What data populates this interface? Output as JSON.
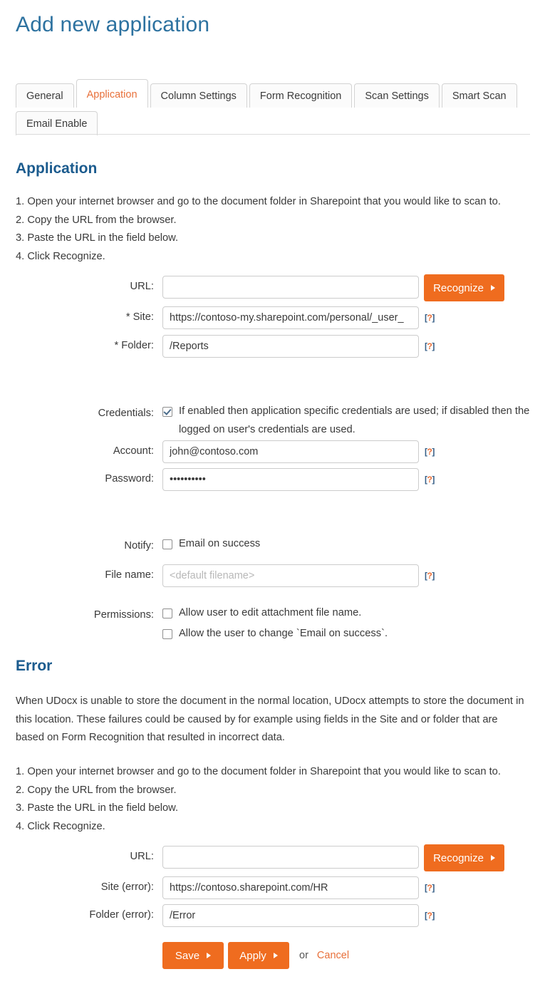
{
  "page": {
    "title": "Add new application"
  },
  "tabs": {
    "row1": [
      {
        "label": "General",
        "active": false
      },
      {
        "label": "Application",
        "active": true
      },
      {
        "label": "Column Settings",
        "active": false
      },
      {
        "label": "Form Recognition",
        "active": false
      },
      {
        "label": "Scan Settings",
        "active": false
      },
      {
        "label": "Smart Scan",
        "active": false
      }
    ],
    "row2": [
      {
        "label": "Email Enable",
        "active": false
      }
    ]
  },
  "application": {
    "heading": "Application",
    "steps": [
      "1. Open your internet browser and go to the document folder in Sharepoint that you would like to scan to.",
      "2. Copy the URL from the browser.",
      "3. Paste the URL in the field below.",
      "4. Click Recognize."
    ],
    "url": {
      "label": "URL:",
      "value": "",
      "placeholder": ""
    },
    "recognize_button": "Recognize",
    "site": {
      "label": "* Site:",
      "value": "https://contoso-my.sharepoint.com/personal/_user_",
      "help": "[?]"
    },
    "folder": {
      "label": "* Folder:",
      "value": "/Reports",
      "help": "[?]"
    },
    "credentials": {
      "label": "Credentials:",
      "checked": true,
      "text": "If enabled then application specific credentials are used; if disabled then the logged on user's credentials are used."
    },
    "account": {
      "label": "Account:",
      "value": "john@contoso.com",
      "help": "[?]"
    },
    "password": {
      "label": "Password:",
      "value": "••••••••••",
      "help": "[?]"
    },
    "notify": {
      "label": "Notify:",
      "checked": false,
      "text": "Email on success"
    },
    "file_name": {
      "label": "File name:",
      "value": "",
      "placeholder": "<default filename>",
      "help": "[?]"
    },
    "permissions": {
      "label": "Permissions:",
      "items": [
        {
          "checked": false,
          "text": "Allow user to edit attachment file name."
        },
        {
          "checked": false,
          "text": "Allow the user to change `Email on success`."
        }
      ]
    }
  },
  "error": {
    "heading": "Error",
    "paragraph": "When UDocx is unable to store the document in the normal location, UDocx attempts to store the document in this location. These failures could be caused by for example using fields in the Site and or folder that are based on Form Recognition that resulted in incorrect data.",
    "steps": [
      "1. Open your internet browser and go to the document folder in Sharepoint that you would like to scan to.",
      "2. Copy the URL from the browser.",
      "3. Paste the URL in the field below.",
      "4. Click Recognize."
    ],
    "url": {
      "label": "URL:",
      "value": "",
      "placeholder": ""
    },
    "recognize_button": "Recognize",
    "site": {
      "label": "Site (error):",
      "value": "https://contoso.sharepoint.com/HR",
      "help": "[?]"
    },
    "folder": {
      "label": "Folder (error):",
      "value": "/Error",
      "help": "[?]"
    }
  },
  "footer": {
    "save_label": "Save",
    "apply_label": "Apply",
    "or_label": "or",
    "cancel_label": "Cancel"
  },
  "colors": {
    "accent_orange": "#ef6c1f",
    "link_orange": "#e8703a",
    "title_blue": "#2d72a0",
    "heading_blue": "#1b5b8e",
    "text": "#3a3a3a"
  }
}
